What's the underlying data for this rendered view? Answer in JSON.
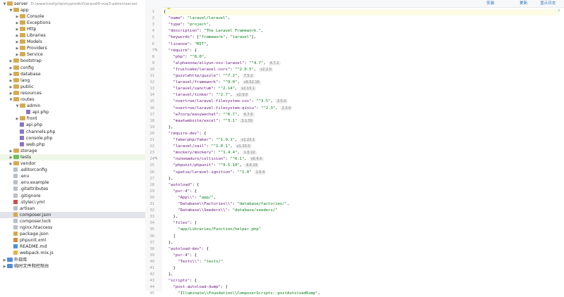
{
  "project": {
    "root_name": "server",
    "root_path": "D:\\www\\root\\php\\myprodict\\laravel9-vue3-admin\\server"
  },
  "tree": [
    {
      "label": "server",
      "type": "folder",
      "depth": 0,
      "open": true,
      "root": true
    },
    {
      "label": "app",
      "type": "folder",
      "depth": 1,
      "open": true
    },
    {
      "label": "Console",
      "type": "folder",
      "depth": 2,
      "open": false
    },
    {
      "label": "Exceptions",
      "type": "folder",
      "depth": 2,
      "open": false
    },
    {
      "label": "Http",
      "type": "folder",
      "depth": 2,
      "open": false
    },
    {
      "label": "Libraries",
      "type": "folder",
      "depth": 2,
      "open": false
    },
    {
      "label": "Models",
      "type": "folder",
      "depth": 2,
      "open": false
    },
    {
      "label": "Providers",
      "type": "folder",
      "depth": 2,
      "open": false
    },
    {
      "label": "Service",
      "type": "folder",
      "depth": 2,
      "open": false
    },
    {
      "label": "bootstrap",
      "type": "folder",
      "depth": 1,
      "open": false
    },
    {
      "label": "config",
      "type": "folder",
      "depth": 1,
      "open": false
    },
    {
      "label": "database",
      "type": "folder",
      "depth": 1,
      "open": false
    },
    {
      "label": "lang",
      "type": "folder",
      "depth": 1,
      "open": false
    },
    {
      "label": "public",
      "type": "folder",
      "depth": 1,
      "open": false
    },
    {
      "label": "resources",
      "type": "folder",
      "depth": 1,
      "open": false
    },
    {
      "label": "routes",
      "type": "folder",
      "depth": 1,
      "open": true
    },
    {
      "label": "admin",
      "type": "folder",
      "depth": 2,
      "open": true
    },
    {
      "label": "api.php",
      "type": "file",
      "ext": "php",
      "depth": 3
    },
    {
      "label": "front",
      "type": "folder",
      "depth": 2,
      "open": false
    },
    {
      "label": "api.php",
      "type": "file",
      "ext": "php",
      "depth": 2
    },
    {
      "label": "channels.php",
      "type": "file",
      "ext": "php",
      "depth": 2
    },
    {
      "label": "console.php",
      "type": "file",
      "ext": "php",
      "depth": 2
    },
    {
      "label": "web.php",
      "type": "file",
      "ext": "php",
      "depth": 2
    },
    {
      "label": "storage",
      "type": "folder",
      "depth": 1,
      "open": false
    },
    {
      "label": "tests",
      "type": "folder",
      "depth": 1,
      "open": false,
      "color": "green",
      "highlight": "green"
    },
    {
      "label": "vendor",
      "type": "folder",
      "depth": 1,
      "open": false
    },
    {
      "label": ".editorconfig",
      "type": "file",
      "ext": "txt",
      "depth": 1
    },
    {
      "label": ".env",
      "type": "file",
      "ext": "txt",
      "depth": 1
    },
    {
      "label": ".env.example",
      "type": "file",
      "ext": "txt",
      "depth": 1
    },
    {
      "label": ".gitattributes",
      "type": "file",
      "ext": "txt",
      "depth": 1
    },
    {
      "label": ".gitignore",
      "type": "file",
      "ext": "txt",
      "depth": 1
    },
    {
      "label": ".styleci.yml",
      "type": "file",
      "ext": "yml",
      "depth": 1
    },
    {
      "label": "artisan",
      "type": "file",
      "ext": "txt",
      "depth": 1
    },
    {
      "label": "composer.json",
      "type": "file",
      "ext": "json",
      "depth": 1,
      "selected": true
    },
    {
      "label": "composer.lock",
      "type": "file",
      "ext": "txt",
      "depth": 1
    },
    {
      "label": "nginx.htaccess",
      "type": "file",
      "ext": "txt",
      "depth": 1
    },
    {
      "label": "package.json",
      "type": "file",
      "ext": "json",
      "depth": 1
    },
    {
      "label": "phpunit.xml",
      "type": "file",
      "ext": "xml",
      "depth": 1
    },
    {
      "label": "README.md",
      "type": "file",
      "ext": "md",
      "depth": 1
    },
    {
      "label": "webpack.mix.js",
      "type": "file",
      "ext": "js",
      "depth": 1
    },
    {
      "label": "外部库",
      "type": "folder",
      "depth": 0,
      "open": false,
      "color": "blue"
    },
    {
      "label": "临时文件和控制台",
      "type": "folder",
      "depth": 0,
      "open": false,
      "color": "blue"
    }
  ],
  "toolbar": {
    "install": "安装",
    "update": "更新",
    "show_log": "显示日志"
  },
  "code": [
    {
      "t": "{"
    },
    {
      "t": "  \"name\": \"laravel/laravel\","
    },
    {
      "t": "  \"type\": \"project\","
    },
    {
      "t": "  \"description\": \"The Laravel Framework.\","
    },
    {
      "t": "  \"keywords\": [\"framework\", \"laravel\"],"
    },
    {
      "t": "  \"license\": \"MIT\","
    },
    {
      "t": "  \"require\": {"
    },
    {
      "t": "    \"php\": \"^8.0\","
    },
    {
      "t": "    \"alphasnow/aliyun-oss-laravel\": \"^4.7\",",
      "h": "4.7.2"
    },
    {
      "t": "    \"fruitcake/laravel-cors\": \"^2.0.5\",",
      "h": "v2.2.0"
    },
    {
      "t": "    \"guzzlehttp/guzzle\": \"^7.2\",",
      "h": "7.5.2"
    },
    {
      "t": "    \"laravel/framework\": \"^9.0\",",
      "h": "v9.52.16"
    },
    {
      "t": "    \"laravel/sanctum\": \"^2.14\",",
      "h": "v2.15.1"
    },
    {
      "t": "    \"laravel/tinker\": \"^2.7\",",
      "h": "v2.9.0"
    },
    {
      "t": "    \"overtrue/laravel-filesystem-cos\": \"^3.5\",",
      "h": "3.5.0"
    },
    {
      "t": "    \"overtrue/laravel-filesystem-qiniu\": \"^2.3\",",
      "h": "2.3.0"
    },
    {
      "t": "    \"w7corp/easywechat\": \"^6.7\",",
      "h": "6.7.0"
    },
    {
      "t": "    \"maatwebsite/excel\": \"^3.1\"",
      "h": "3.1.55"
    },
    {
      "t": "  },"
    },
    {
      "t": "  \"require-dev\": {"
    },
    {
      "t": "    \"fakerphp/faker\": \"^1.9.1\",",
      "h": "v1.23.1"
    },
    {
      "t": "    \"laravel/sail\": \"^1.0.1\",",
      "h": "v1.33.0"
    },
    {
      "t": "    \"mockery/mockery\": \"^1.4.4\",",
      "h": "1.6.12"
    },
    {
      "t": "    \"nunomaduro/collision\": \"^6.1\",",
      "h": "v6.4.0"
    },
    {
      "t": "    \"phpunit/phpunit\": \"^9.5.10\",",
      "h": "9.6.19"
    },
    {
      "t": "    \"spatie/laravel-ignition\": \"^1.0\"",
      "h": "1.6.4"
    },
    {
      "t": "  },"
    },
    {
      "t": "  \"autoload\": {"
    },
    {
      "t": "    \"psr-4\": {"
    },
    {
      "t": "      \"App\\\\\": \"app/\","
    },
    {
      "t": "      \"Database\\\\Factories\\\\\": \"database/factories/\","
    },
    {
      "t": "      \"Database\\\\Seeders\\\\\": \"database/seeders/\""
    },
    {
      "t": "    },"
    },
    {
      "t": "    \"files\": ["
    },
    {
      "t": "      \"app/Libraries/Function/helper.php\""
    },
    {
      "t": "    ]"
    },
    {
      "t": "  },"
    },
    {
      "t": "  \"autoload-dev\": {"
    },
    {
      "t": "    \"psr-4\": {"
    },
    {
      "t": "      \"Tests\\\\\": \"tests/\""
    },
    {
      "t": "    }"
    },
    {
      "t": "  },"
    },
    {
      "t": "  \"scripts\": {"
    },
    {
      "t": "    \"post-autoload-dump\": ["
    },
    {
      "t": "      \"Illuminate\\\\Foundation\\\\ComposerScripts::postAutoloadDump\","
    }
  ]
}
